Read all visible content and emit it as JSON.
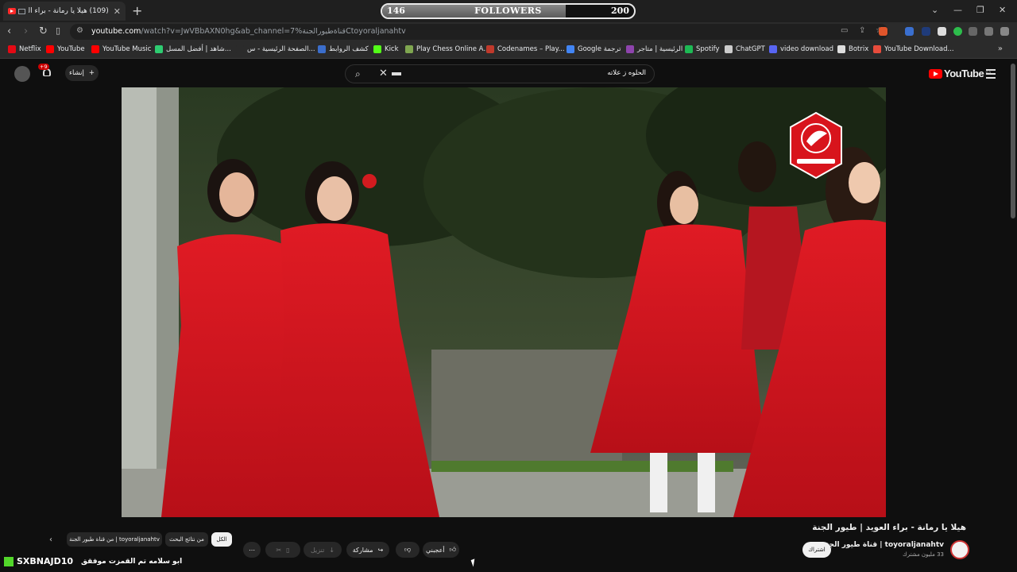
{
  "browser": {
    "tab_title": "(109) هيلا يا رمانة - براء العويد",
    "followers_current": "146",
    "followers_label": "FOLLOWERS",
    "followers_goal": "200",
    "followers_progress": 0.73,
    "url_host": "youtube.com",
    "url_rest": "/watch?v=JwVBbAXN0hg&ab_channel=قناةطيورالجنة%7Ctoyoraljanahtv",
    "bookmarks": [
      {
        "label": "Netflix",
        "color": "#e50914"
      },
      {
        "label": "YouTube",
        "color": "#ff0000"
      },
      {
        "label": "YouTube Music",
        "color": "#ff0000"
      },
      {
        "label": "شاهد | أفضل المسل...",
        "color": "#2ecc71"
      },
      {
        "label": "الصفحة الرئيسية - س...",
        "color": "#2b2b2b"
      },
      {
        "label": "كشف الروابط",
        "color": "#3b6ecc"
      },
      {
        "label": "Kick",
        "color": "#53fc18"
      },
      {
        "label": "Play Chess Online A...",
        "color": "#7fa650"
      },
      {
        "label": "Codenames – Play...",
        "color": "#c0392b"
      },
      {
        "label": "Google ترجمة",
        "color": "#4285f4"
      },
      {
        "label": "الرئيسية | متاجر",
        "color": "#8e44ad"
      },
      {
        "label": "Spotify",
        "color": "#1db954"
      },
      {
        "label": "ChatGPT",
        "color": "#cccccc"
      },
      {
        "label": "video download",
        "color": "#5865f2"
      },
      {
        "label": "Botrix",
        "color": "#dddddd"
      },
      {
        "label": "YouTube Download...",
        "color": "#e74c3c"
      }
    ]
  },
  "youtube": {
    "notif_badge": "+9",
    "create_label": "إنشاء",
    "search_query": "الحلوه ز علاته",
    "logo_text": "YouTube",
    "logo_region": "SA",
    "video_title": "هيلا يا رمانة - براء العويد | طيور الجنة",
    "channel_name": "toyoraljanahtv | قناة طيور الجنة",
    "channel_subs": "33 مليون مشترك",
    "subscribe_label": "اشتراك",
    "like_label": "أعجبني",
    "share_label": "مشاركة",
    "download_label": "تنزيل",
    "chips": [
      "الكل",
      "من نتائج البحث",
      "من قناة طيور الجنة | toyoraljanahtv"
    ],
    "overlay_user": "SXBNAJD10",
    "overlay_text": "ابو سلامه تم القمزت موفقق"
  }
}
